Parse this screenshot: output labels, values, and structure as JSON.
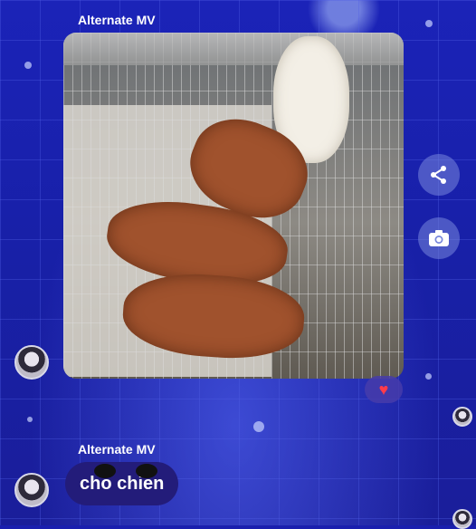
{
  "messages": [
    {
      "sender": "Alternate MV",
      "type": "photo",
      "reaction_icon": "heart-icon"
    },
    {
      "sender": "Alternate MV",
      "type": "text",
      "text": "cho chien"
    }
  ],
  "actions": {
    "share_icon": "share-icon",
    "camera_icon": "camera-icon"
  },
  "colors": {
    "background": "#1a1fae",
    "bubble": "#231c7a",
    "reaction": "#ff3b4a"
  }
}
